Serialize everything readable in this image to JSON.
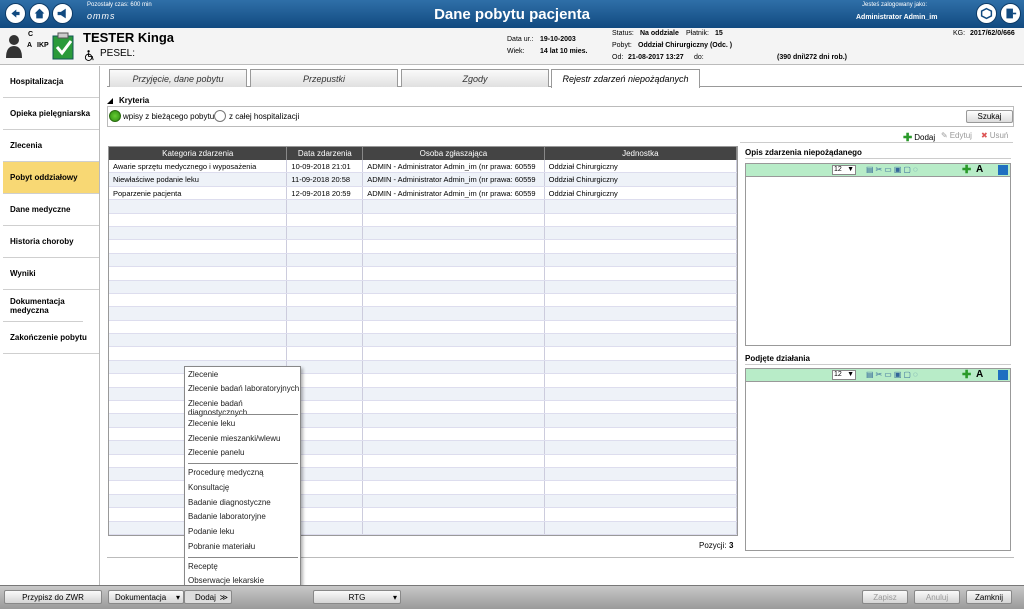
{
  "top": {
    "time_left": "Pozostały czas: 600 min",
    "app_logo": "omms",
    "title": "Dane pobytu pacjenta",
    "logged_label": "Jesteś zalogowany jako:",
    "user": "Administrator Admin_im"
  },
  "patient": {
    "badge_c": "C",
    "badge_a": "A",
    "badge_ikp": "IKP",
    "name": "TESTER Kinga",
    "pesel_label": "PESEL:",
    "dob_label": "Data ur.:",
    "dob": "19-10-2003",
    "age_label": "Wiek:",
    "age": "14 lat 10 mies.",
    "status_label": "Status:",
    "status": "Na oddziale",
    "payer_label": "Płatnik:",
    "payer": "15",
    "stay_label": "Pobyt:",
    "stay": "Oddział Chirurgiczny (Odc. )",
    "from_label": "Od:",
    "from": "21-08-2017 13:27",
    "to_label": "do:",
    "days": "(390 dni\\272 dni rob.)",
    "kg_label": "KG:",
    "kg": "2017/62/0/666"
  },
  "sidebar": [
    "Hospitalizacja",
    "Opieka pielęgniarska",
    "Zlecenia",
    "Pobyt oddziałowy",
    "Dane medyczne",
    "Historia choroby",
    "Wyniki",
    "Dokumentacja medyczna",
    "Zakończenie pobytu"
  ],
  "tabs": [
    "Przyjęcie, dane pobytu",
    "Przepustki",
    "Zgody",
    "Rejestr zdarzeń niepożądanych"
  ],
  "criteria": {
    "label": "Kryteria",
    "opt1": "wpisy z bieżącego pobytu",
    "opt2": "z całej hospitalizacji",
    "search": "Szukaj"
  },
  "toolbar": {
    "add": "Dodaj",
    "edit": "Edytuj",
    "delete": "Usuń"
  },
  "grid": {
    "headers": [
      "Kategoria zdarzenia",
      "Data zdarzenia",
      "Osoba zgłaszająca",
      "Jednostka"
    ],
    "rows": [
      [
        "Awarie sprzętu medycznego i wyposażenia",
        "10-09-2018  21:01",
        "ADMIN - Administrator Admin_im (nr prawa: 60559",
        "Oddział Chirurgiczny"
      ],
      [
        "Niewłaściwe podanie leku",
        "11-09-2018  20:58",
        "ADMIN - Administrator Admin_im (nr prawa: 60559",
        "Oddział Chirurgiczny"
      ],
      [
        "Poparzenie pacjenta",
        "12-09-2018  20:59",
        "ADMIN - Administrator Admin_im (nr prawa: 60559",
        "Oddział Chirurgiczny"
      ]
    ],
    "count_label": "Pozycji:",
    "count": "3"
  },
  "right": {
    "desc_title": "Opis zdarzenia niepożądanego",
    "actions_title": "Podjęte działania",
    "font_size": "12"
  },
  "context_menu": [
    "Zlecenie",
    "Zlecenie badań laboratoryjnych",
    "Zlecenie badań diagnostycznych",
    "Zlecenie leku",
    "Zlecenie mieszanki/wlewu",
    "Zlecenie panelu",
    "Procedurę medyczną",
    "Konsultację",
    "Badanie diagnostyczne",
    "Badanie laboratoryjne",
    "Podanie leku",
    "Pobranie materiału",
    "Receptę",
    "Obserwacje lekarskie"
  ],
  "bottom": {
    "zwr": "Przypisz do ZWR",
    "doc": "Dokumentacja",
    "add": "Dodaj",
    "rtg": "RTG",
    "save": "Zapisz",
    "cancel": "Anuluj",
    "close": "Zamknij"
  }
}
